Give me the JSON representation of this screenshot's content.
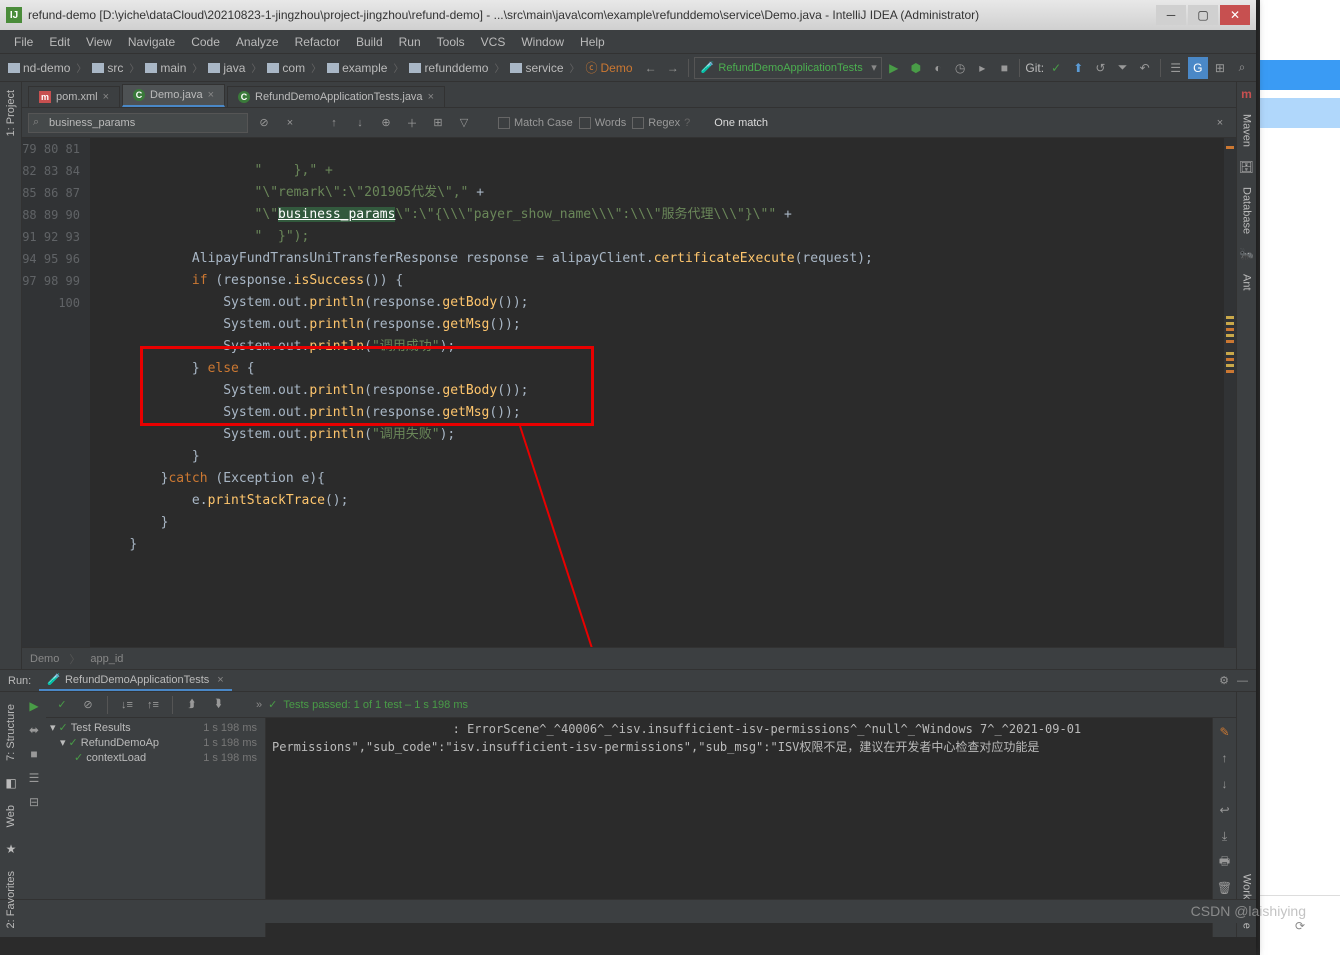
{
  "titlebar": {
    "text": "refund-demo [D:\\yiche\\dataCloud\\20210823-1-jingzhou\\project-jingzhou\\refund-demo] - ...\\src\\main\\java\\com\\example\\refunddemo\\service\\Demo.java - IntelliJ IDEA (Administrator)"
  },
  "menu": [
    "File",
    "Edit",
    "View",
    "Navigate",
    "Code",
    "Analyze",
    "Refactor",
    "Build",
    "Run",
    "Tools",
    "VCS",
    "Window",
    "Help"
  ],
  "breadcrumb": [
    "nd-demo",
    "src",
    "main",
    "java",
    "com",
    "example",
    "refunddemo",
    "service",
    "Demo"
  ],
  "run_config": "RefundDemoApplicationTests",
  "git_label": "Git:",
  "editor_tabs": [
    {
      "label": "pom.xml",
      "icon": "m",
      "active": false
    },
    {
      "label": "Demo.java",
      "icon": "c",
      "active": true
    },
    {
      "label": "RefundDemoApplicationTests.java",
      "icon": "c",
      "active": false
    }
  ],
  "find": {
    "value": "business_params",
    "match_case": "Match Case",
    "words": "Words",
    "regex": "Regex",
    "count": "One match"
  },
  "gutters_left": [
    "1: Project"
  ],
  "gutters_left_bottom": [
    "2: Favorites",
    "Web",
    "7: Structure"
  ],
  "gutters_right": [
    "Maven",
    "Database",
    "Ant"
  ],
  "gutters_right_bottom": [
    "Workspace"
  ],
  "lines": {
    "start": 79,
    "count": 22
  },
  "code": {
    "l79": "\"    },\" +",
    "l80_a": "\"\\\"remark\\\":\\\"201905代发\\\",\"",
    "l80_b": " +",
    "l81_a": "\"\\\"",
    "l81_hl": "business_params",
    "l81_b": "\\\":\\\"{\\\\\\\"payer_show_name\\\\\\\":\\\\\\\"服务代理\\\\\\\"}\\\"\"",
    "l81_c": " +",
    "l82": "\"  }\");",
    "l83_a": "AlipayFundTransUniTransferResponse response = alipayClient.",
    "l83_call": "certificateExecute",
    "l83_b": "(request);",
    "l84_a": "if (response.",
    "l84_call": "isSuccess",
    "l84_b": "()) {",
    "l85_a": "System.out.",
    "l85_p": "println",
    "l85_b": "(response.",
    "l85_c": "getBody",
    "l85_d": "());",
    "l86_a": "System.out.",
    "l86_p": "println",
    "l86_b": "(response.",
    "l86_c": "getMsg",
    "l86_d": "());",
    "l87_a": "System.out.",
    "l87_p": "println",
    "l87_b": "(",
    "l87_s": "\"调用成功\"",
    "l87_c": ");",
    "l88": "} else {",
    "l89_a": "System.out.",
    "l89_p": "println",
    "l89_b": "(response.",
    "l89_c": "getBody",
    "l89_d": "());",
    "l90_a": "System.out.",
    "l90_p": "println",
    "l90_b": "(response.",
    "l90_c": "getMsg",
    "l90_d": "());",
    "l91_a": "System.out.",
    "l91_p": "println",
    "l91_b": "(",
    "l91_s": "\"调用失败\"",
    "l91_c": ");",
    "l92": "}",
    "l93": "}catch (Exception e){",
    "l94_a": "e.",
    "l94_p": "printStackTrace",
    "l94_b": "();",
    "l95": "}",
    "l96": "}"
  },
  "crumb_bottom": [
    "Demo",
    "app_id"
  ],
  "run": {
    "title": "Run:",
    "tab": "RefundDemoApplicationTests",
    "passed": "Tests passed: 1 of 1 test – 1 s 198 ms",
    "tree": [
      {
        "label": "Test Results",
        "time": "1 s 198 ms",
        "indent": 0
      },
      {
        "label": "RefundDemoAp",
        "time": "1 s 198 ms",
        "indent": 1
      },
      {
        "label": "contextLoad",
        "time": "1 s 198 ms",
        "indent": 2
      }
    ],
    "console_l1": "                         : ErrorScene^_^40006^_^isv.insufficient-isv-permissions^_^null^_^Windows 7^_^2021-09-01 ",
    "console_l2": "Permissions\",\"sub_code\":\"isv.insufficient-isv-permissions\",\"sub_msg\":\"ISV权限不足，建议在开发者中心检查对应功能是"
  },
  "watermark": "CSDN @laishiying"
}
